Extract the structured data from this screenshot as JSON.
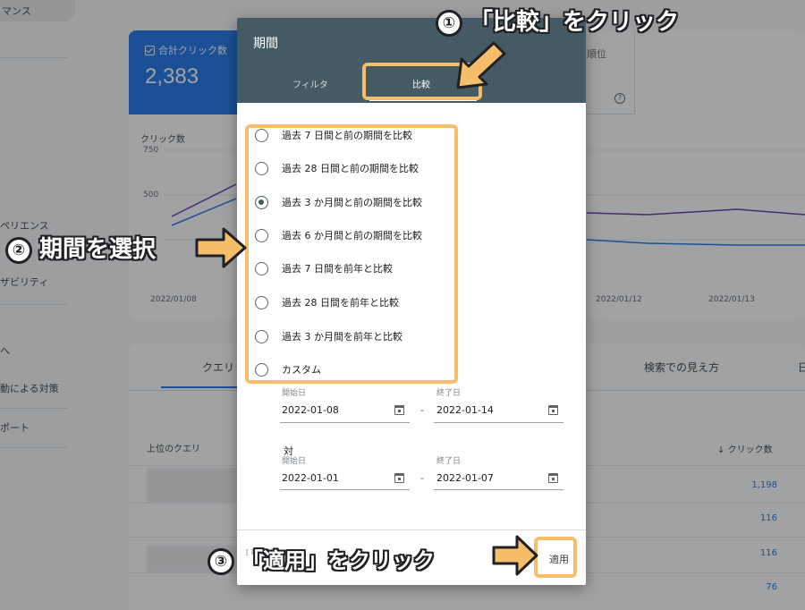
{
  "background": {
    "sidebar": {
      "top_item": "マンス",
      "items": [
        "ペリエンス",
        "ザビリティ",
        "へ",
        "動による対策",
        "ポート"
      ]
    },
    "metrics": {
      "clicks_label": "合計クリック数",
      "clicks_value": "2,383",
      "right_label": "順位",
      "help": "?"
    },
    "chart": {
      "ylabel": "クリック数",
      "yticks": [
        "750",
        "500"
      ],
      "xticks": [
        "2022/01/08",
        "2022/01/12",
        "2022/01/13"
      ]
    },
    "table": {
      "tab_queries": "クエリ",
      "tab_appearance": "検索での見え方",
      "tab_edge": "日",
      "col_top_queries": "上位のクエリ",
      "col_clicks": "クリック数",
      "sort_arrow": "↓",
      "rows": [
        "1,198",
        "116",
        "116",
        "76"
      ]
    }
  },
  "dialog": {
    "title": "期間",
    "tabs": {
      "filter": "フィルタ",
      "compare": "比較"
    },
    "options": [
      {
        "label": "過去 7 日間と前の期間を比較",
        "selected": false
      },
      {
        "label": "過去 28 日間と前の期間を比較",
        "selected": false
      },
      {
        "label": "過去 3 か月間と前の期間を比較",
        "selected": true
      },
      {
        "label": "過去 6 か月間と前の期間を比較",
        "selected": false
      },
      {
        "label": "過去 7 日間を前年と比較",
        "selected": false
      },
      {
        "label": "過去 28 日間を前年と比較",
        "selected": false
      },
      {
        "label": "過去 3 か月間を前年と比較",
        "selected": false
      },
      {
        "label": "カスタム",
        "selected": false
      }
    ],
    "range1": {
      "start_label": "開始日",
      "start": "2022-01-08",
      "end_label": "終了日",
      "end": "2022-01-14"
    },
    "vs_label": "対",
    "range2": {
      "start_label": "開始日",
      "start": "2022-01-01",
      "end_label": "終了日",
      "end": "2022-01-07"
    },
    "dash": "-",
    "footer_partial": "[ 期間 す。",
    "apply": "適用"
  },
  "annotations": {
    "step1": {
      "num": "①",
      "text": "「比較」をクリック"
    },
    "step2": {
      "num": "②",
      "text": "期間を選択"
    },
    "step3": {
      "num": "③",
      "text": "「適用」をクリック"
    },
    "color": "#f6be6a"
  },
  "colors": {
    "dialog_header": "#455a64",
    "accent": "#1a73e8",
    "series_purple": "#5e35b1"
  }
}
